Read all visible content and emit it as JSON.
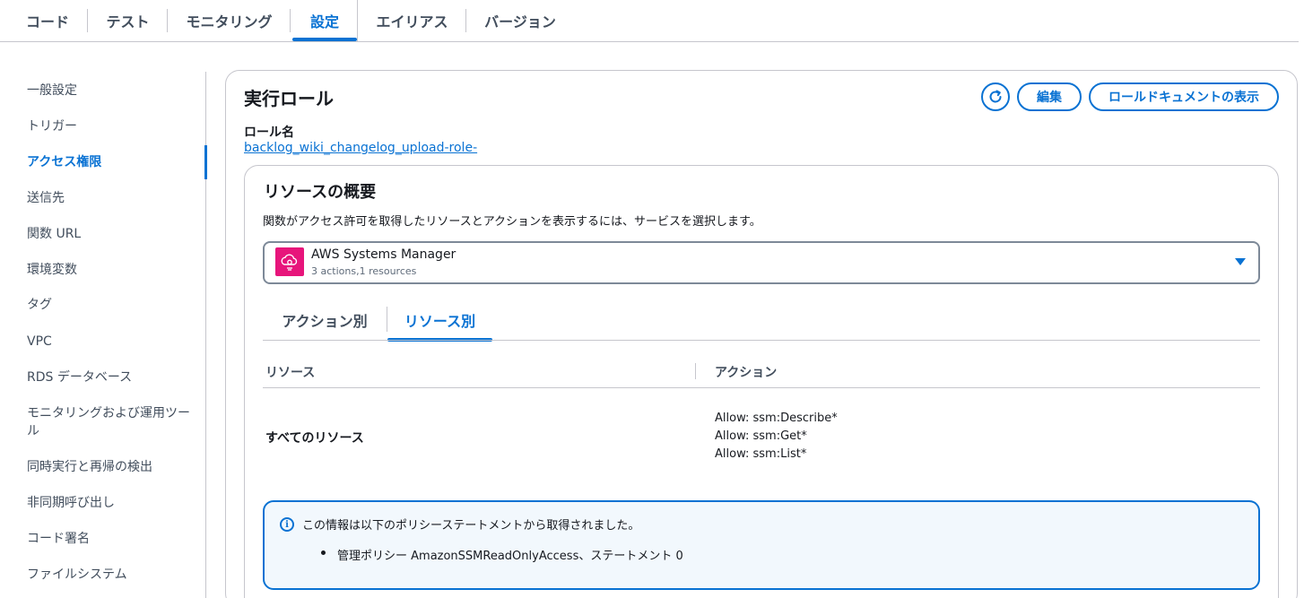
{
  "top_tabs": [
    {
      "label": "コード"
    },
    {
      "label": "テスト"
    },
    {
      "label": "モニタリング"
    },
    {
      "label": "設定"
    },
    {
      "label": "エイリアス"
    },
    {
      "label": "バージョン"
    }
  ],
  "active_top_tab": "設定",
  "sidebar": {
    "items": [
      {
        "label": "一般設定"
      },
      {
        "label": "トリガー"
      },
      {
        "label": "アクセス権限"
      },
      {
        "label": "送信先"
      },
      {
        "label": "関数 URL"
      },
      {
        "label": "環境変数"
      },
      {
        "label": "タグ"
      },
      {
        "label": "VPC"
      },
      {
        "label": "RDS データベース"
      },
      {
        "label": "モニタリングおよび運用ツール"
      },
      {
        "label": "同時実行と再帰の検出"
      },
      {
        "label": "非同期呼び出し"
      },
      {
        "label": "コード署名"
      },
      {
        "label": "ファイルシステム"
      }
    ],
    "active_item": "アクセス権限"
  },
  "execution_role": {
    "title": "実行ロール",
    "edit_label": "編集",
    "view_doc_label": "ロールドキュメントの表示",
    "role_name_label": "ロール名",
    "role_name": "backlog_wiki_changelog_upload-role-"
  },
  "resource_summary": {
    "title": "リソースの概要",
    "description": "関数がアクセス許可を取得したリソースとアクションを表示するには、サービスを選択します。",
    "service": {
      "name": "AWS Systems Manager",
      "summary": "3 actions,1 resources",
      "icon": "systems-manager-icon"
    },
    "tabs": [
      {
        "label": "アクション別"
      },
      {
        "label": "リソース別"
      }
    ],
    "active_tab": "リソース別",
    "table": {
      "columns": [
        "リソース",
        "アクション"
      ],
      "rows": [
        {
          "resource": "すべてのリソース",
          "actions": [
            "Allow: ssm:Describe*",
            "Allow: ssm:Get*",
            "Allow: ssm:List*"
          ]
        }
      ]
    },
    "info": {
      "text": "この情報は以下のポリシーステートメントから取得されました。",
      "items": [
        "管理ポリシー AmazonSSMReadOnlyAccess、ステートメント 0"
      ]
    }
  },
  "colors": {
    "accent": "#0972d3",
    "service_icon": "#e7157b",
    "info_bg": "#f2f8fd"
  }
}
